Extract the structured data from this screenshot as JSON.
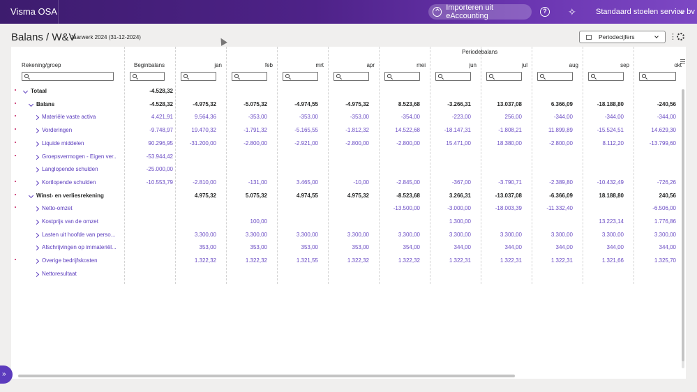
{
  "app": {
    "name": "Visma OSA"
  },
  "topbar": {
    "import_label": "Importeren uit eAccounting",
    "company_name": "Standaard stoelen service bv"
  },
  "page": {
    "title": "Balans / W&V",
    "subtitle": "Jaarwerk 2024 (31-12-2024)",
    "period_select": "Periodecijfers"
  },
  "table": {
    "group_header": "Periodebalans",
    "col_account": "Rekening/groep",
    "col_opening": "Beginbalans",
    "months": [
      "jan",
      "feb",
      "mrt",
      "apr",
      "mei",
      "jun",
      "jul",
      "aug",
      "sep",
      "okt"
    ],
    "rows": [
      {
        "label": "Totaal",
        "level": 0,
        "bold": true,
        "dot": true,
        "expanded": true,
        "begin": "-4.528,32",
        "values": [
          "",
          "",
          "",
          "",
          "",
          "",
          "",
          "",
          "",
          ""
        ]
      },
      {
        "label": "Balans",
        "level": 1,
        "bold": true,
        "dot": true,
        "expanded": true,
        "begin": "-4.528,32",
        "values": [
          "-4.975,32",
          "-5.075,32",
          "-4.974,55",
          "-4.975,32",
          "8.523,68",
          "-3.266,31",
          "13.037,08",
          "6.366,09",
          "-18.188,80",
          "-240,56"
        ]
      },
      {
        "label": "Materiële vaste activa",
        "level": 2,
        "bold": false,
        "dot": true,
        "expanded": false,
        "begin": "4.421,91",
        "values": [
          "9.564,36",
          "-353,00",
          "-353,00",
          "-353,00",
          "-354,00",
          "-223,00",
          "256,00",
          "-344,00",
          "-344,00",
          "-344,00"
        ]
      },
      {
        "label": "Vorderingen",
        "level": 2,
        "bold": false,
        "dot": true,
        "expanded": false,
        "begin": "-9.748,97",
        "values": [
          "19.470,32",
          "-1.791,32",
          "-5.165,55",
          "-1.812,32",
          "14.522,68",
          "-18.147,31",
          "-1.808,21",
          "11.899,89",
          "-15.524,51",
          "14.629,30"
        ]
      },
      {
        "label": "Liquide middelen",
        "level": 2,
        "bold": false,
        "dot": true,
        "expanded": false,
        "begin": "90.296,95",
        "values": [
          "-31.200,00",
          "-2.800,00",
          "-2.921,00",
          "-2.800,00",
          "-2.800,00",
          "15.471,00",
          "18.380,00",
          "-2.800,00",
          "8.112,20",
          "-13.799,60"
        ]
      },
      {
        "label": "Groepsvermogen - Eigen ver...",
        "level": 2,
        "bold": false,
        "dot": true,
        "expanded": false,
        "begin": "-53.944,42",
        "values": [
          "",
          "",
          "",
          "",
          "",
          "",
          "",
          "",
          "",
          ""
        ]
      },
      {
        "label": "Langlopende schulden",
        "level": 2,
        "bold": false,
        "dot": false,
        "expanded": false,
        "begin": "-25.000,00",
        "values": [
          "",
          "",
          "",
          "",
          "",
          "",
          "",
          "",
          "",
          ""
        ]
      },
      {
        "label": "Kortlopende schulden",
        "level": 2,
        "bold": false,
        "dot": true,
        "expanded": false,
        "begin": "-10.553,79",
        "values": [
          "-2.810,00",
          "-131,00",
          "3.465,00",
          "-10,00",
          "-2.845,00",
          "-367,00",
          "-3.790,71",
          "-2.389,80",
          "-10.432,49",
          "-726,26"
        ]
      },
      {
        "label": "Winst- en verliesrekening",
        "level": 1,
        "bold": true,
        "dot": true,
        "expanded": true,
        "begin": "",
        "values": [
          "4.975,32",
          "5.075,32",
          "4.974,55",
          "4.975,32",
          "-8.523,68",
          "3.266,31",
          "-13.037,08",
          "-6.366,09",
          "18.188,80",
          "240,56"
        ]
      },
      {
        "label": "Netto-omzet",
        "level": 2,
        "bold": false,
        "dot": true,
        "expanded": false,
        "begin": "",
        "values": [
          "",
          "",
          "",
          "",
          "-13.500,00",
          "-3.000,00",
          "-18.003,39",
          "-11.332,40",
          "",
          "-6.506,00"
        ]
      },
      {
        "label": "Kostprijs van de omzet",
        "level": 2,
        "bold": false,
        "dot": false,
        "expanded": false,
        "begin": "",
        "values": [
          "",
          "100,00",
          "",
          "",
          "",
          "1.300,00",
          "",
          "",
          "13.223,14",
          "1.776,86"
        ]
      },
      {
        "label": "Lasten uit hoofde van perso...",
        "level": 2,
        "bold": false,
        "dot": false,
        "expanded": false,
        "begin": "",
        "values": [
          "3.300,00",
          "3.300,00",
          "3.300,00",
          "3.300,00",
          "3.300,00",
          "3.300,00",
          "3.300,00",
          "3.300,00",
          "3.300,00",
          "3.300,00"
        ]
      },
      {
        "label": "Afschrijvingen op immateriël...",
        "level": 2,
        "bold": false,
        "dot": false,
        "expanded": false,
        "begin": "",
        "values": [
          "353,00",
          "353,00",
          "353,00",
          "353,00",
          "354,00",
          "344,00",
          "344,00",
          "344,00",
          "344,00",
          "344,00"
        ]
      },
      {
        "label": "Overige bedrijfskosten",
        "level": 2,
        "bold": false,
        "dot": true,
        "expanded": false,
        "begin": "",
        "values": [
          "1.322,32",
          "1.322,32",
          "1.321,55",
          "1.322,32",
          "1.322,32",
          "1.322,31",
          "1.322,31",
          "1.322,31",
          "1.321,66",
          "1.325,70"
        ]
      },
      {
        "label": "Nettoresultaat",
        "level": 2,
        "bold": false,
        "dot": false,
        "expanded": false,
        "begin": "",
        "values": [
          "",
          "",
          "",
          "",
          "",
          "",
          "",
          "",
          "",
          ""
        ]
      }
    ]
  }
}
